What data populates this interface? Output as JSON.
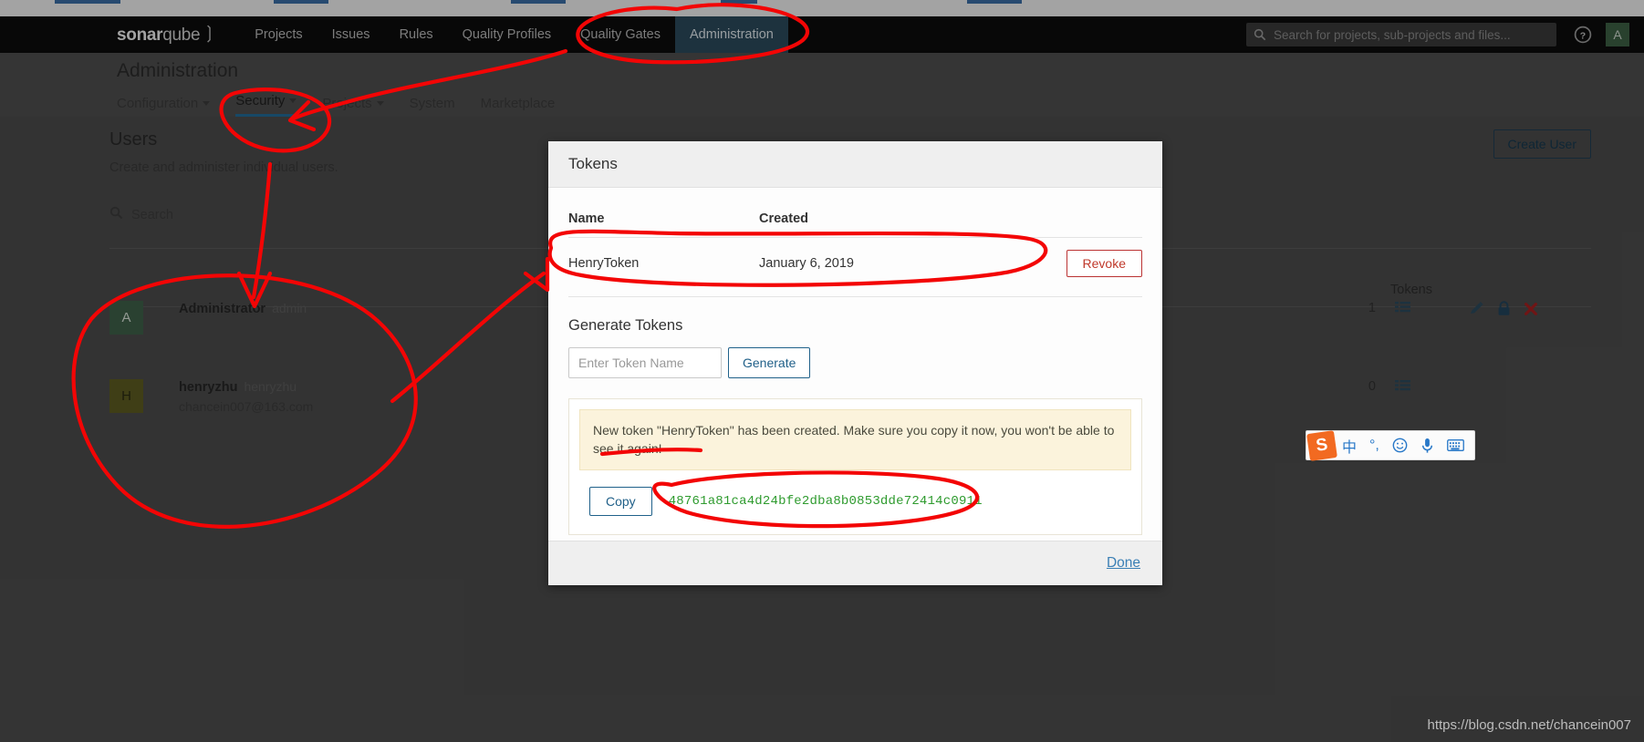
{
  "topnav": {
    "brand_bold": "sonar",
    "brand_light": "qube",
    "links": [
      {
        "label": "Projects",
        "active": false
      },
      {
        "label": "Issues",
        "active": false
      },
      {
        "label": "Rules",
        "active": false
      },
      {
        "label": "Quality Profiles",
        "active": false
      },
      {
        "label": "Quality Gates",
        "active": false
      },
      {
        "label": "Administration",
        "active": true
      }
    ],
    "search_placeholder": "Search for projects, sub-projects and files...",
    "help_icon": "help-circle-icon",
    "avatar_initial": "A"
  },
  "page_header": {
    "title": "Administration",
    "subnav": [
      {
        "label": "Configuration",
        "caret": true,
        "active": false
      },
      {
        "label": "Security",
        "caret": true,
        "active": true
      },
      {
        "label": "Projects",
        "caret": true,
        "active": false
      },
      {
        "label": "System",
        "caret": false,
        "active": false
      },
      {
        "label": "Marketplace",
        "caret": false,
        "active": false
      }
    ]
  },
  "users_page": {
    "title": "Users",
    "subtitle": "Create and administer individual users.",
    "create_button": "Create User",
    "search_placeholder": "Search",
    "tokens_column_header": "Tokens",
    "rows": [
      {
        "avatar_initial": "A",
        "name": "Administrator",
        "login": "admin",
        "email": "",
        "tokens": "1",
        "actions": [
          "pencil-icon",
          "lock-icon",
          "delete-x-icon"
        ]
      },
      {
        "avatar_initial": "H",
        "name": "henryzhu",
        "login": "henryzhu",
        "email": "chancein007@163.com",
        "tokens": "0",
        "actions": []
      }
    ]
  },
  "modal": {
    "title": "Tokens",
    "table": {
      "headers": [
        "Name",
        "Created",
        ""
      ],
      "rows": [
        {
          "name": "HenryToken",
          "created": "January 6, 2019",
          "action_label": "Revoke"
        }
      ]
    },
    "generate": {
      "title": "Generate Tokens",
      "input_placeholder": "Enter Token Name",
      "input_value": "",
      "button_label": "Generate"
    },
    "result": {
      "alert": "New token \"HenryToken\" has been created. Make sure you copy it now, you won't be able to see it again!",
      "copy_button": "Copy",
      "token_value": "48761a81ca4d24bfe2dba8b0853dde72414c0911",
      "token_color": "#2e9b2e"
    },
    "footer_action": "Done"
  },
  "ime_toolbar": {
    "logo": "S",
    "items": [
      "中",
      "°,",
      "☺",
      "🎤",
      "⌨"
    ]
  },
  "watermark": "https://blog.csdn.net/chancein007",
  "colors": {
    "nav_bg": "#0d0d0d",
    "nav_active": "#2c4a5c",
    "accent_blue": "#236a97",
    "annotation_red": "#f00000",
    "token_green": "#2e9b2e"
  }
}
